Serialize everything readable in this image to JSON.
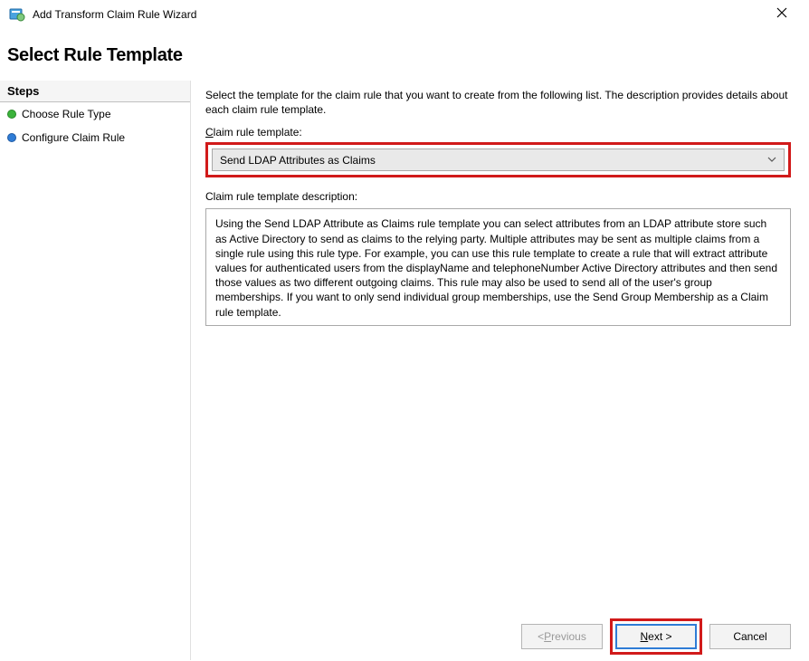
{
  "titlebar": {
    "title": "Add Transform Claim Rule Wizard"
  },
  "header": {
    "title": "Select Rule Template"
  },
  "sidebar": {
    "steps_title": "Steps",
    "items": [
      {
        "label": "Choose Rule Type",
        "bullet": "green"
      },
      {
        "label": "Configure Claim Rule",
        "bullet": "blue"
      }
    ]
  },
  "main": {
    "intro": "Select the template for the claim rule that you want to create from the following list. The description provides details about each claim rule template.",
    "template_label_pre": "",
    "template_label_u": "C",
    "template_label_post": "laim rule template:",
    "dropdown_value": "Send LDAP Attributes as Claims",
    "desc_label": "Claim rule template description:",
    "description": "Using the Send LDAP Attribute as Claims rule template you can select attributes from an LDAP attribute store such as Active Directory to send as claims to the relying party. Multiple attributes may be sent as multiple claims from a single rule using this rule type. For example, you can use this rule template to create a rule that will extract attribute values for authenticated users from the displayName and telephoneNumber Active Directory attributes and then send those values as two different outgoing claims. This rule may also be used to send all of the user's group memberships. If you want to only send individual group memberships, use the Send Group Membership as a Claim rule template."
  },
  "buttons": {
    "previous_pre": "< ",
    "previous_u": "P",
    "previous_post": "revious",
    "next_u": "N",
    "next_post": "ext >",
    "cancel": "Cancel"
  }
}
